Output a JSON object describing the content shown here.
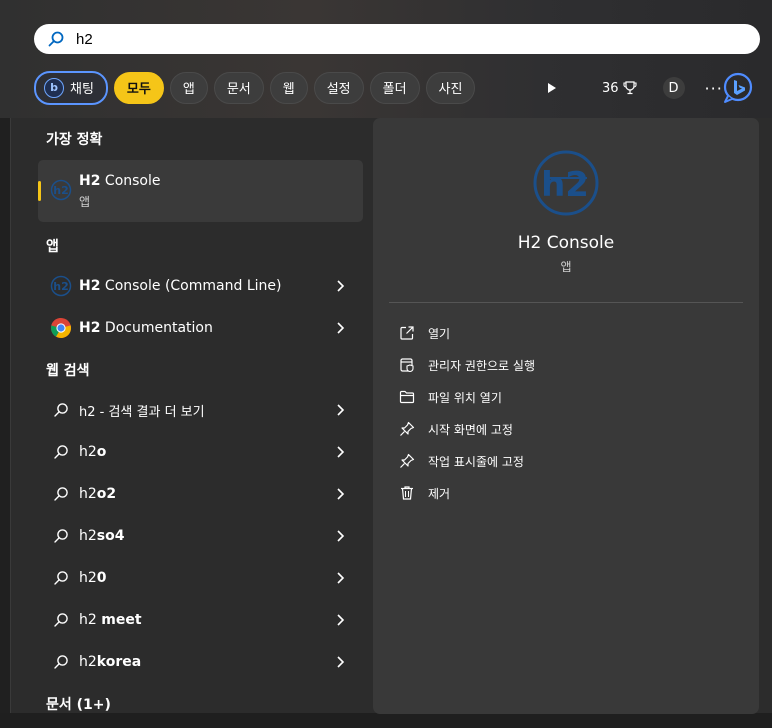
{
  "search": {
    "value": "h2"
  },
  "chips": {
    "chat": "채팅",
    "all": "모두",
    "apps": "앱",
    "documents": "문서",
    "web": "웹",
    "settings": "설정",
    "folders": "폴더",
    "photos": "사진"
  },
  "toolbar": {
    "points": "36",
    "avatar_letter": "D",
    "more": "···"
  },
  "best_match": {
    "heading": "가장 정확",
    "name_bold": "H2",
    "name_rest": " Console",
    "type": "앱"
  },
  "apps_section": {
    "heading": "앱",
    "items": [
      {
        "bold": "H2",
        "rest": " Console (Command Line)",
        "icon": "h2-app-icon"
      },
      {
        "bold": "H2",
        "rest": " Documentation",
        "icon": "chrome-icon"
      }
    ]
  },
  "web_section": {
    "heading": "웹 검색",
    "items": [
      {
        "plain": "h2 - 검색 결과 더 보기",
        "bold": ""
      },
      {
        "plain": "h2",
        "bold": "o"
      },
      {
        "plain": "h2",
        "bold": "o2"
      },
      {
        "plain": "h2",
        "bold": "so4"
      },
      {
        "plain": "h2",
        "bold": "0"
      },
      {
        "plain": "h2 ",
        "bold": "meet"
      },
      {
        "plain": "h2",
        "bold": "korea"
      }
    ]
  },
  "documents_section": {
    "heading": "문서 (1+)"
  },
  "detail": {
    "title": "H2 Console",
    "subtitle": "앱",
    "actions": [
      {
        "label": "열기",
        "icon": "open-external-icon"
      },
      {
        "label": "관리자 권한으로 실행",
        "icon": "run-as-admin-icon"
      },
      {
        "label": "파일 위치 열기",
        "icon": "folder-icon"
      },
      {
        "label": "시작 화면에 고정",
        "icon": "pin-icon"
      },
      {
        "label": "작업 표시줄에 고정",
        "icon": "pin-icon"
      },
      {
        "label": "제거",
        "icon": "trash-icon"
      }
    ]
  },
  "colors": {
    "accent": "#f5c518",
    "chat_border": "#5b95ff",
    "panel": "#393939",
    "h2_logo": "#1b4f8a"
  }
}
